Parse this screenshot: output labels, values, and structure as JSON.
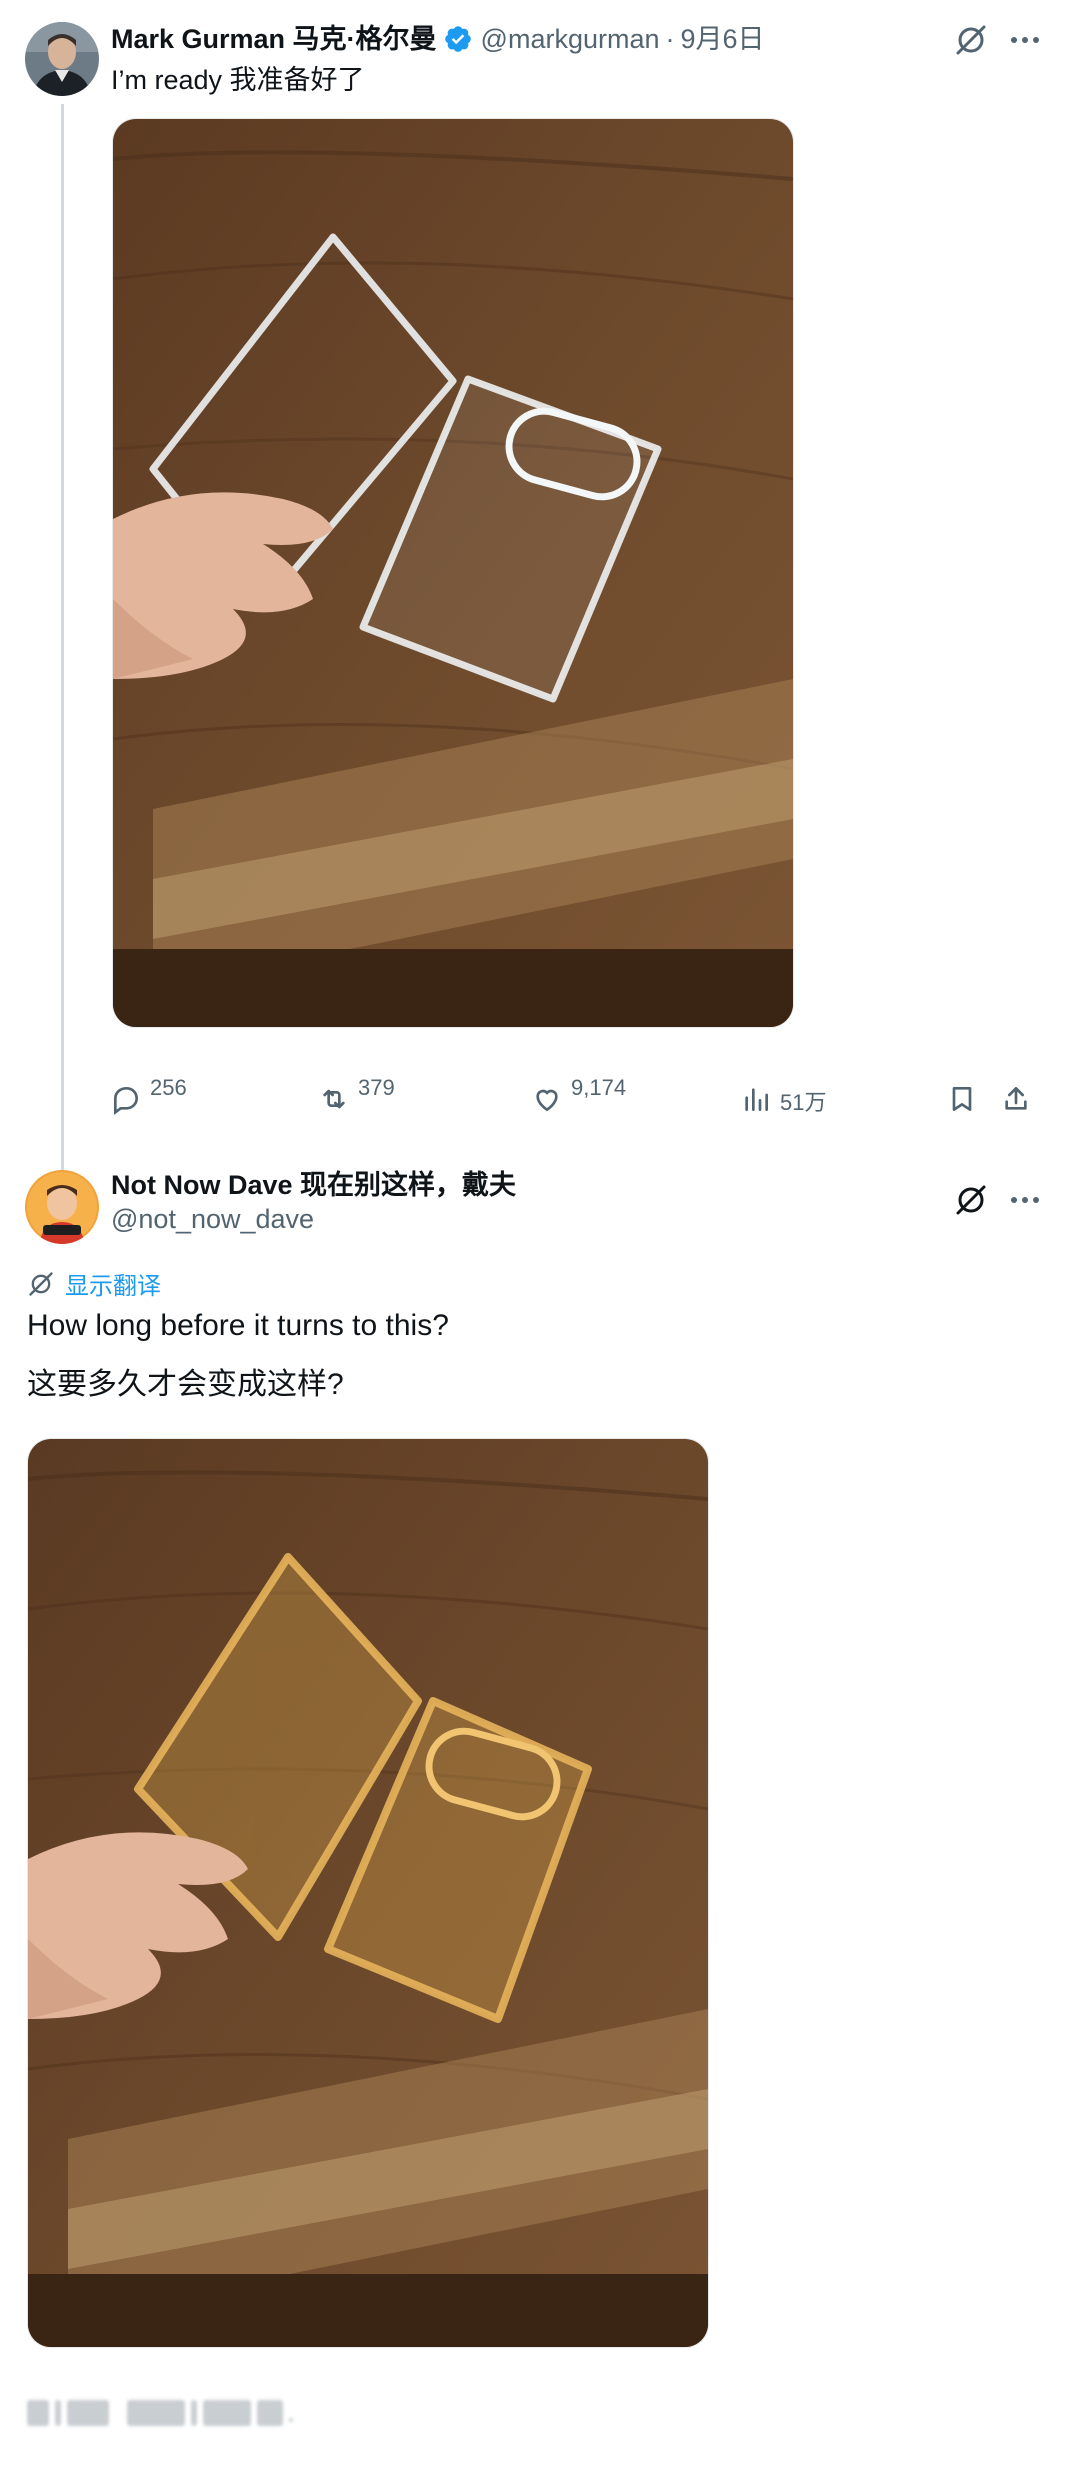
{
  "tweet1": {
    "author_name": "Mark Gurman 马克·格尔曼",
    "handle": "@markgurman",
    "separator": "·",
    "date": "9月6日",
    "text": "I’m ready 我准备好了",
    "stats": {
      "replies": "256",
      "retweets": "379",
      "likes": "9,174",
      "views": "51万"
    }
  },
  "tweet2": {
    "author_name": "Not Now Dave 现在别这样，戴夫",
    "handle": "@not_now_dave",
    "translate_label": "显示翻译",
    "text_en": "How long before it turns to this?",
    "text_zh": "这要多久才会变成这样?"
  },
  "colors": {
    "accent": "#1d9bf0",
    "secondary_text": "#536471",
    "thread_line": "#cfd9de"
  }
}
